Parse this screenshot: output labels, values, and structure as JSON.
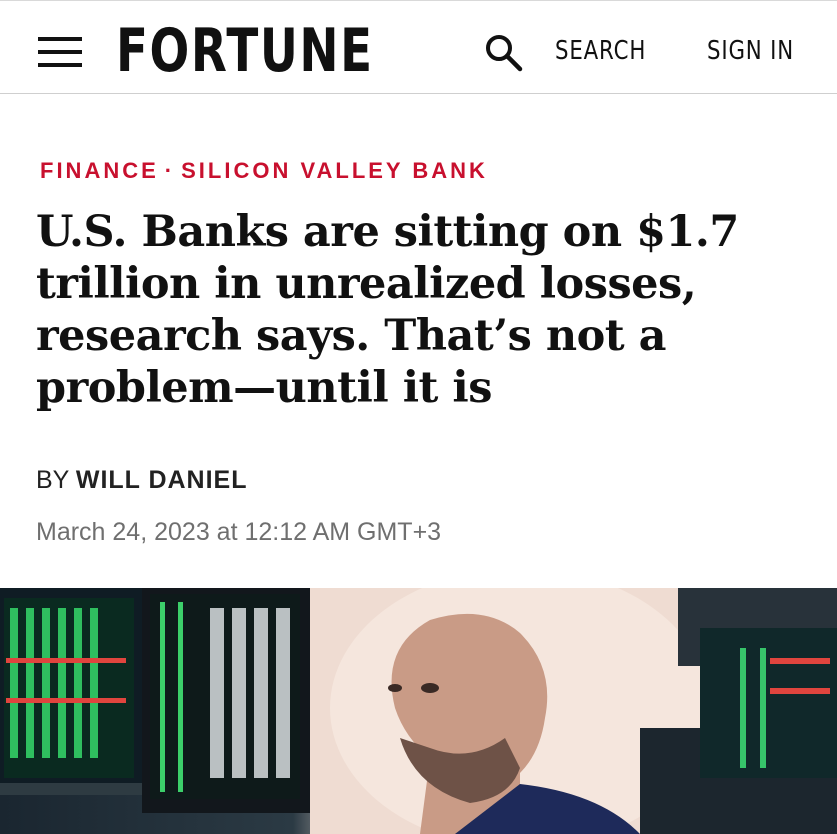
{
  "header": {
    "logo": "FORTUNE",
    "search_label": "SEARCH",
    "signin_label": "SIGN IN"
  },
  "article": {
    "kicker": {
      "section": "FINANCE",
      "separator": "·",
      "topic": "SILICON VALLEY BANK"
    },
    "headline": "U.S. Banks are sitting on $1.7 trillion in unrealized losses, research says. That’s not a problem—until it is",
    "byline_prefix": "BY",
    "author": "WILL DANIEL",
    "date": "March 24, 2023 at 12:12 AM GMT+3"
  },
  "colors": {
    "kicker": "#c8102e",
    "text": "#111111",
    "date": "#6f6f6f"
  },
  "icons": [
    "menu-icon",
    "search-icon"
  ]
}
